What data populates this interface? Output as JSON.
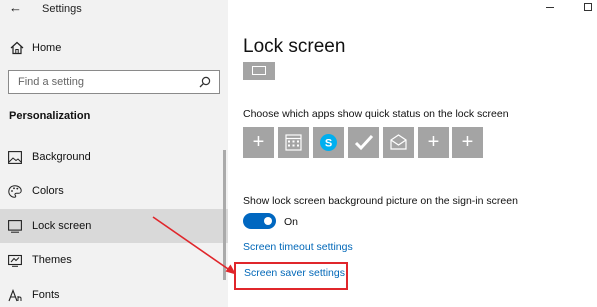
{
  "window": {
    "app_title": "Settings"
  },
  "sidebar": {
    "home_label": "Home",
    "search_placeholder": "Find a setting",
    "section_heading": "Personalization",
    "items": [
      {
        "label": "Background",
        "icon": "image-icon"
      },
      {
        "label": "Colors",
        "icon": "palette-icon"
      },
      {
        "label": "Lock screen",
        "icon": "lock-screen-icon",
        "selected": true
      },
      {
        "label": "Themes",
        "icon": "themes-icon"
      },
      {
        "label": "Fonts",
        "icon": "fonts-icon"
      }
    ]
  },
  "main": {
    "page_title": "Lock screen",
    "quick_status_label": "Choose which apps show quick status on the lock screen",
    "quick_status_apps": [
      {
        "icon": "plus-icon"
      },
      {
        "icon": "calendar-icon"
      },
      {
        "icon": "skype-icon"
      },
      {
        "icon": "checkmark-icon"
      },
      {
        "icon": "mail-icon"
      },
      {
        "icon": "plus-icon"
      },
      {
        "icon": "plus-icon"
      }
    ],
    "signin_background_label": "Show lock screen background picture on the sign-in screen",
    "signin_background_state": "On",
    "screen_timeout_link": "Screen timeout settings",
    "screen_saver_link": "Screen saver settings"
  },
  "colors": {
    "accent": "#0067c0",
    "link": "#0067b8",
    "highlight": "#e0262b",
    "tile": "#a4a4a4",
    "skype": "#00aff0"
  }
}
